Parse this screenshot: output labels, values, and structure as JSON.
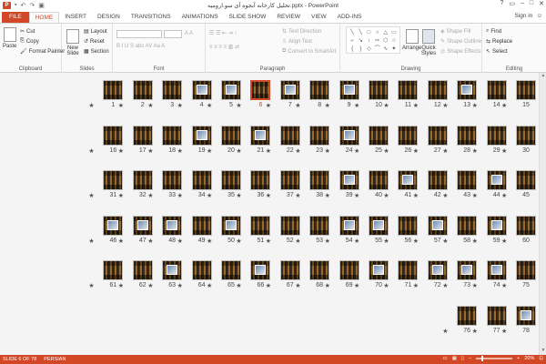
{
  "app": {
    "icon_letter": "P",
    "title": "تحلیل کارخانه آبجوه آی سو.ارومیه.pptx - PowerPoint",
    "window_controls": [
      "?",
      "▭",
      "–",
      "□",
      "✕"
    ]
  },
  "tabs": [
    "FILE",
    "HOME",
    "INSERT",
    "DESIGN",
    "TRANSITIONS",
    "ANIMATIONS",
    "SLIDE SHOW",
    "REVIEW",
    "VIEW",
    "ADD-INS"
  ],
  "active_tab": "HOME",
  "signin": "Sign in",
  "ribbon": {
    "clipboard": {
      "paste": "Paste",
      "cut": "Cut",
      "copy": "Copy",
      "format_painter": "Format Painter",
      "label": "Clipboard"
    },
    "slides": {
      "new_slide": "New Slide",
      "layout": "Layout",
      "reset": "Reset",
      "section": "Section",
      "label": "Slides"
    },
    "font": {
      "label": "Font"
    },
    "paragraph": {
      "text_direction": "Text Direction",
      "align_text": "Align Text",
      "convert": "Convert to SmartArt",
      "label": "Paragraph"
    },
    "drawing": {
      "arrange": "Arrange",
      "quick_styles": "Quick Styles",
      "shape_fill": "Shape Fill",
      "shape_outline": "Shape Outline",
      "shape_effects": "Shape Effects",
      "label": "Drawing"
    },
    "editing": {
      "find": "Find",
      "replace": "Replace",
      "select": "Select",
      "label": "Editing"
    }
  },
  "slides": {
    "selected": "6",
    "rows": [
      [
        "15",
        "14",
        "13",
        "12",
        "11",
        "10",
        "9",
        "8",
        "7",
        "6",
        "5",
        "4",
        "3",
        "2",
        "1"
      ],
      [
        "30",
        "29",
        "28",
        "27",
        "26",
        "25",
        "24",
        "23",
        "22",
        "21",
        "20",
        "19",
        "18",
        "17",
        "16"
      ],
      [
        "45",
        "44",
        "43",
        "42",
        "41",
        "40",
        "39",
        "38",
        "37",
        "36",
        "35",
        "34",
        "33",
        "32",
        "31"
      ],
      [
        "60",
        "59",
        "58",
        "57",
        "56",
        "55",
        "54",
        "53",
        "52",
        "51",
        "50",
        "49",
        "48",
        "47",
        "46"
      ],
      [
        "75",
        "74",
        "73",
        "72",
        "71",
        "70",
        "69",
        "68",
        "67",
        "66",
        "65",
        "64",
        "63",
        "62",
        "61"
      ],
      [
        "78",
        "77",
        "76"
      ]
    ]
  },
  "status": {
    "slide_indicator": "SLIDE 6 OF 78",
    "language": "PERSIAN",
    "zoom": "20%"
  }
}
